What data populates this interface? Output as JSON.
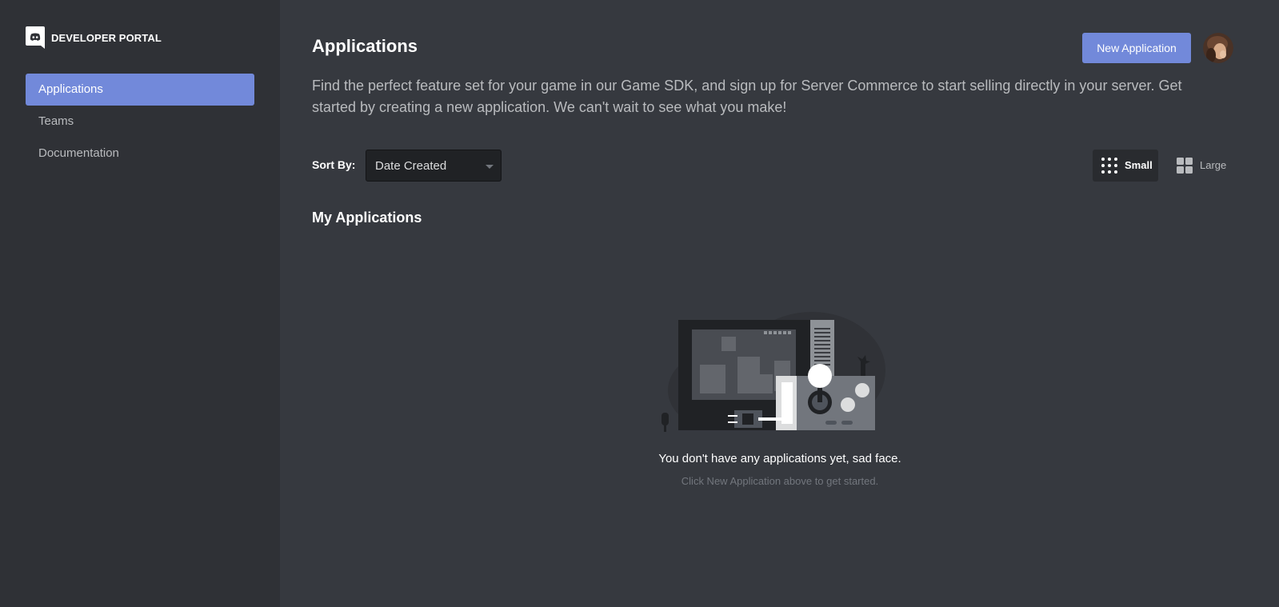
{
  "sidebar": {
    "brand_text": "DEVELOPER PORTAL",
    "brand_icon": "discord-logo-icon",
    "items": [
      {
        "label": "Applications",
        "active": true
      },
      {
        "label": "Teams",
        "active": false
      },
      {
        "label": "Documentation",
        "active": false
      }
    ]
  },
  "header": {
    "title": "Applications",
    "new_button_label": "New Application",
    "avatar_icon": "user-avatar"
  },
  "intro": {
    "description": "Find the perfect feature set for your game in our Game SDK, and sign up for Server Commerce to start selling directly in your server. Get started by creating a new application. We can't wait to see what you make!"
  },
  "toolbar": {
    "sort_label": "Sort By:",
    "sort_value": "Date Created",
    "view_small_label": "Small",
    "view_large_label": "Large",
    "view_selected": "Small"
  },
  "apps": {
    "section_title": "My Applications",
    "empty_title": "You don't have any applications yet, sad face.",
    "empty_subtitle": "Click New Application above to get started."
  },
  "colors": {
    "accent": "#7289da",
    "sidebar_bg": "#2f3136",
    "main_bg": "#36393f"
  }
}
